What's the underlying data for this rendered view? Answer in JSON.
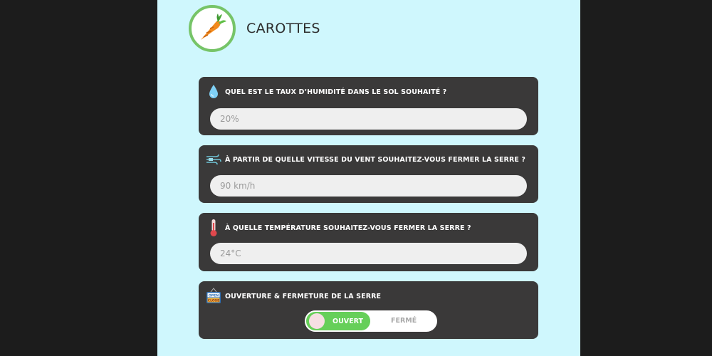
{
  "header": {
    "title": "CAROTTES",
    "avatar_icon": "carrot-icon"
  },
  "questions": [
    {
      "icon": "water-drop-icon",
      "label": "QUEL EST LE TAUX D’HUMIDITÉ DANS LE SOL SOUHAITÉ ?",
      "placeholder": "20%"
    },
    {
      "icon": "wind-icon",
      "label": "À PARTIR DE QUELLE VITESSE DU VENT SOUHAITEZ-VOUS FERMER LA SERRE ?",
      "placeholder": "90 km/h"
    },
    {
      "icon": "thermometer-icon",
      "label": "À QUELLE TEMPÉRATURE SOUHAITEZ-VOUS FERMER LA SERRE ?",
      "placeholder": "24°C"
    }
  ],
  "door": {
    "icon": "open-close-sign-icon",
    "label": "OUVERTURE & FERMETURE DE LA SERRE",
    "sign_text_top": "OPEN",
    "sign_text_bottom": "CLOSE",
    "on_label": "OUVERT",
    "off_label": "FERMÉ",
    "state": "OUVERT"
  },
  "colors": {
    "page_background": "#cff7fd",
    "card_background": "#3a3939",
    "toggle_active": "#66cf59",
    "avatar_border": "#76c468"
  }
}
